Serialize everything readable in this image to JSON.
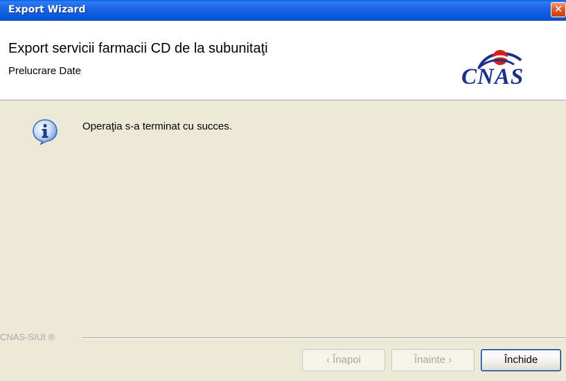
{
  "window": {
    "title": "Export Wizard",
    "close_glyph": "✕"
  },
  "header": {
    "title": "Export servicii farmacii CD de la subunitaţi",
    "subtitle": "Prelucrare Date",
    "logo_text": "CNAS"
  },
  "content": {
    "icon": "info-icon",
    "message": "Operaţia s-a terminat cu succes."
  },
  "footer": {
    "brand": "CNAS-SIUI ®",
    "buttons": {
      "back": "‹ Înapoi",
      "next": "Înainte ›",
      "close": "Închide"
    }
  },
  "colors": {
    "titlebar": "#0A5FE0",
    "dialog_bg": "#ECE9D8",
    "logo": "#1C2F8C",
    "logo_accent": "#D2241B"
  }
}
